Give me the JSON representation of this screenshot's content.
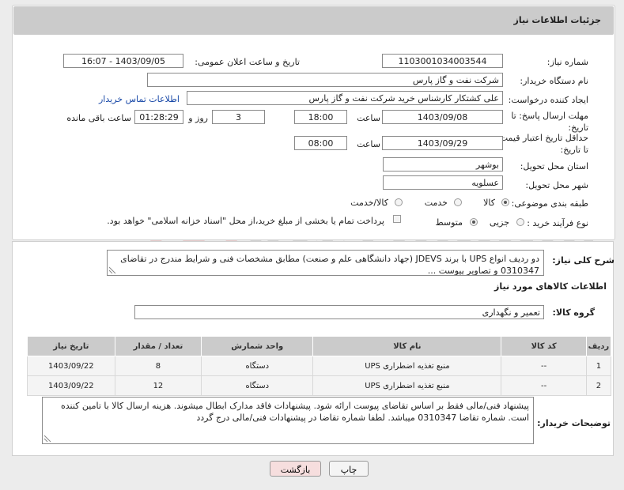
{
  "header": {
    "title": "جزئیات اطلاعات نیاز"
  },
  "form": {
    "need_number_label": "شماره نیاز:",
    "need_number": "1103001034003544",
    "announce_label": "تاریخ و ساعت اعلان عمومی:",
    "announce_value": "1403/09/05 - 16:07",
    "buyer_org_label": "نام دستگاه خریدار:",
    "buyer_org": "شرکت نفت و گاز پارس",
    "creator_label": "ایجاد کننده درخواست:",
    "creator": "علی کشتکار کارشناس خرید شرکت نفت و گاز پارس",
    "contact_link": "اطلاعات تماس خریدار",
    "deadline_label": "مهلت ارسال پاسخ: تا تاریخ:",
    "deadline_date": "1403/09/08",
    "time_label": "ساعت",
    "deadline_time": "18:00",
    "days_value": "3",
    "days_label": "روز و",
    "remaining_time": "01:28:29",
    "remaining_label": "ساعت باقی مانده",
    "validity_label": "حداقل تاریخ اعتبار قیمت: تا تاریخ:",
    "validity_date": "1403/09/29",
    "validity_time": "08:00",
    "province_label": "استان محل تحویل:",
    "province": "بوشهر",
    "city_label": "شهر محل تحویل:",
    "city": "عسلویه",
    "category_label": "طبقه بندی موضوعی:",
    "category_options": [
      "کالا",
      "خدمت",
      "کالا/خدمت"
    ],
    "category_selected": "کالا",
    "process_label": "نوع فرآیند خرید :",
    "process_options": [
      "جزیی",
      "متوسط"
    ],
    "payment_text": "پرداخت تمام یا بخشی از مبلغ خرید،از محل \"اسناد خزانه اسلامی\" خواهد بود."
  },
  "description": {
    "label": "شرح کلی نیاز:",
    "text": "دو ردیف انواع UPS با برند JDEVS (جهاد دانشگاهی علم و صنعت) مطابق مشخصات فنی و شرایط مندرج در تقاضای 0310347 و تصاویر پیوست ..."
  },
  "goods_section": {
    "title": "اطلاعات کالاهای مورد نیاز",
    "group_label": "گروه کالا:",
    "group_value": "تعمیر و نگهداری"
  },
  "table": {
    "headers": [
      "ردیف",
      "کد کالا",
      "نام کالا",
      "واحد شمارش",
      "تعداد / مقدار",
      "تاریخ نیاز"
    ],
    "rows": [
      [
        "1",
        "--",
        "منبع تغذیه اضطراری UPS",
        "دستگاه",
        "8",
        "1403/09/22"
      ],
      [
        "2",
        "--",
        "منبع تغذیه اضطراری UPS",
        "دستگاه",
        "12",
        "1403/09/22"
      ]
    ]
  },
  "buyer_notes": {
    "label": "توضیحات خریدار:",
    "text": "پیشنهاد فنی/مالی فقط بر اساس تقاضای پیوست ارائه شود. پیشنهادات فاقد مدارک ابطال میشوند. هزینه ارسال کالا با تامین کننده است. شماره تقاضا 0310347 میباشد. لطفا شماره تقاضا در پیشنهادات فنی/مالی درج گردد"
  },
  "buttons": {
    "print": "چاپ",
    "back": "بازگشت"
  },
  "colors": {
    "header_bg": "#cbcbcb",
    "link": "#1a4aa8",
    "back_button_bg": "#f6dede",
    "print_button_bg": "#f4f4f4"
  }
}
